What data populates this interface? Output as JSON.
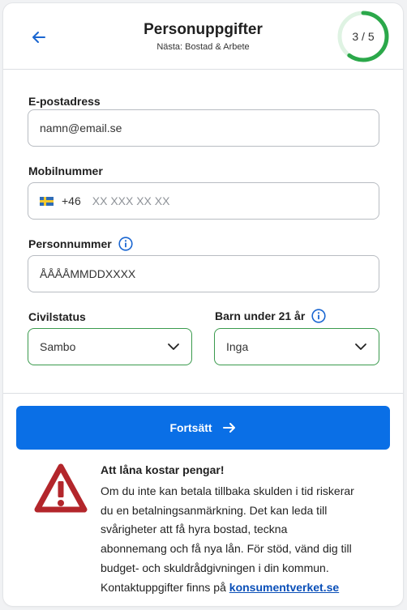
{
  "header": {
    "title": "Personuppgifter",
    "subtitle": "Nästa: Bostad & Arbete",
    "progress_label": "3 / 5",
    "progress_fraction": 0.6
  },
  "form": {
    "email": {
      "label": "E-postadress",
      "placeholder": "namn@email.se"
    },
    "mobile": {
      "label": "Mobilnummer",
      "country_code": "+46",
      "placeholder": "XX XXX XX XX"
    },
    "personal_number": {
      "label": "Personnummer",
      "placeholder": "ÅÅÅÅMMDDXXXX"
    },
    "civil_status": {
      "label": "Civilstatus",
      "value": "Sambo"
    },
    "children": {
      "label": "Barn under 21 år",
      "value": "Inga"
    }
  },
  "cta": {
    "label": "Fortsätt"
  },
  "warning": {
    "title": "Att låna kostar pengar!",
    "body_lines": [
      "Om du inte kan betala tillbaka skulden i tid riskerar",
      "du en betalningsanmärkning. Det kan leda till",
      "svårigheter att få hyra bostad, teckna",
      "abonnemang och få nya lån. För stöd, vänd dig till",
      "budget- och skuldrådgivningen i din kommun."
    ],
    "contact_prefix": "Kontaktuppgifter finns på",
    "link_text": "konsumentverket.se"
  },
  "colors": {
    "primary": "#0a6fe6",
    "progress_green": "#2ba84a",
    "select_border": "#3a9a4d",
    "warning_red": "#b3262b"
  }
}
